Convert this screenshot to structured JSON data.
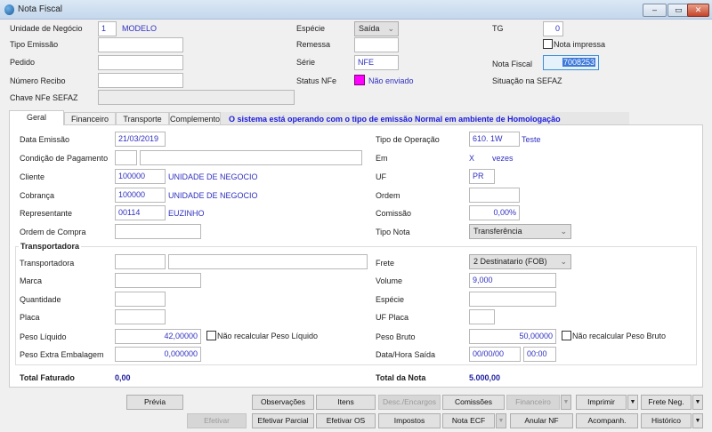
{
  "window": {
    "title": "Nota Fiscal",
    "minimize": "–",
    "maximize": "▭",
    "close": "✕"
  },
  "header": {
    "unidade_label": "Unidade de Negócio",
    "unidade_value": "1",
    "unidade_name": "MODELO",
    "tipo_emissao_label": "Tipo Emissão",
    "tipo_emissao_value": "",
    "pedido_label": "Pedido",
    "pedido_value": "",
    "numero_recibo_label": "Número Recibo",
    "numero_recibo_value": "",
    "chave_label": "Chave NFe SEFAZ",
    "chave_value": "",
    "especie_label": "Espécie",
    "especie_value": "Saída",
    "remessa_label": "Remessa",
    "remessa_value": "",
    "serie_label": "Série",
    "serie_value": "NFE",
    "status_label": "Status NFe",
    "status_value": "Não enviado",
    "status_color": "#ff00ff",
    "tg_label": "TG",
    "tg_value": "0",
    "nota_impressa_label": "Nota impressa",
    "nota_impressa_checked": false,
    "nota_fiscal_label": "Nota Fiscal",
    "nota_fiscal_value": "7008253",
    "situacao_label": "Situação na SEFAZ"
  },
  "tabs": [
    {
      "label": "Geral",
      "active": true
    },
    {
      "label": "Financeiro"
    },
    {
      "label": "Transporte"
    },
    {
      "label": "Complemento"
    }
  ],
  "message": "O sistema está operando com o tipo de emissão Normal em ambiente de Homologação",
  "geral": {
    "data_emissao_label": "Data Emissão",
    "data_emissao": "21/03/2019",
    "cond_pag_label": "Condição de Pagamento",
    "cond_pag_code": "",
    "cond_pag_desc": "",
    "cliente_label": "Cliente",
    "cliente_code": "100000",
    "cliente_name": "UNIDADE DE NEGOCIO",
    "cobranca_label": "Cobrança",
    "cobranca_code": "100000",
    "cobranca_name": "UNIDADE DE NEGOCIO",
    "representante_label": "Representante",
    "representante_code": "00114",
    "representante_name": "EUZINHO",
    "ordem_compra_label": "Ordem de Compra",
    "ordem_compra": "",
    "tipo_operacao_label": "Tipo de Operação",
    "tipo_operacao": "610. 1W",
    "tipo_operacao_desc": "Teste",
    "em_label": "Em",
    "em_x": "X",
    "em_vezes": "vezes",
    "uf_label": "UF",
    "uf": "PR",
    "ordem_label": "Ordem",
    "ordem": "",
    "comissao_label": "Comissão",
    "comissao": "0,00%",
    "tipo_nota_label": "Tipo Nota",
    "tipo_nota": "Transferência"
  },
  "transp": {
    "group_title": "Transportadora",
    "transportadora_label": "Transportadora",
    "transportadora_code": "",
    "transportadora_name": "",
    "marca_label": "Marca",
    "marca": "",
    "quantidade_label": "Quantidade",
    "quantidade": "",
    "placa_label": "Placa",
    "placa": "",
    "peso_liquido_label": "Peso Líquido",
    "peso_liquido": "42,00000",
    "nao_recalc_liq": "Não recalcular Peso Líquido",
    "peso_extra_label": "Peso Extra Embalagem",
    "peso_extra": "0,000000",
    "frete_label": "Frete",
    "frete": "2 Destinatario (FOB)",
    "volume_label": "Volume",
    "volume": "9,000",
    "especie_label": "Espécie",
    "especie": "",
    "uf_placa_label": "UF Placa",
    "uf_placa": "",
    "peso_bruto_label": "Peso Bruto",
    "peso_bruto": "50,00000",
    "nao_recalc_bruto": "Não recalcular Peso Bruto",
    "data_hora_label": "Data/Hora Saída",
    "data_saida": "00/00/00",
    "hora_saida": "00:00"
  },
  "totals": {
    "faturado_label": "Total Faturado",
    "faturado": "0,00",
    "nota_label": "Total da Nota",
    "nota": "5.000,00"
  },
  "buttons": {
    "previa": "Prévia",
    "observacoes": "Observações",
    "itens": "Itens",
    "desc_encargos": "Desc./Encargos",
    "comissoes": "Comissões",
    "financeiro": "Financeiro",
    "imprimir": "Imprimir",
    "frete_neg": "Frete Neg.",
    "efetivar": "Efetivar",
    "efetivar_parcial": "Efetivar Parcial",
    "efetivar_os": "Efetivar OS",
    "impostos": "Impostos",
    "nota_ecf": "Nota ECF",
    "anular_nf": "Anular NF",
    "acompanh": "Acompanh.",
    "historico": "Histórico",
    "dropdown": "▼"
  }
}
